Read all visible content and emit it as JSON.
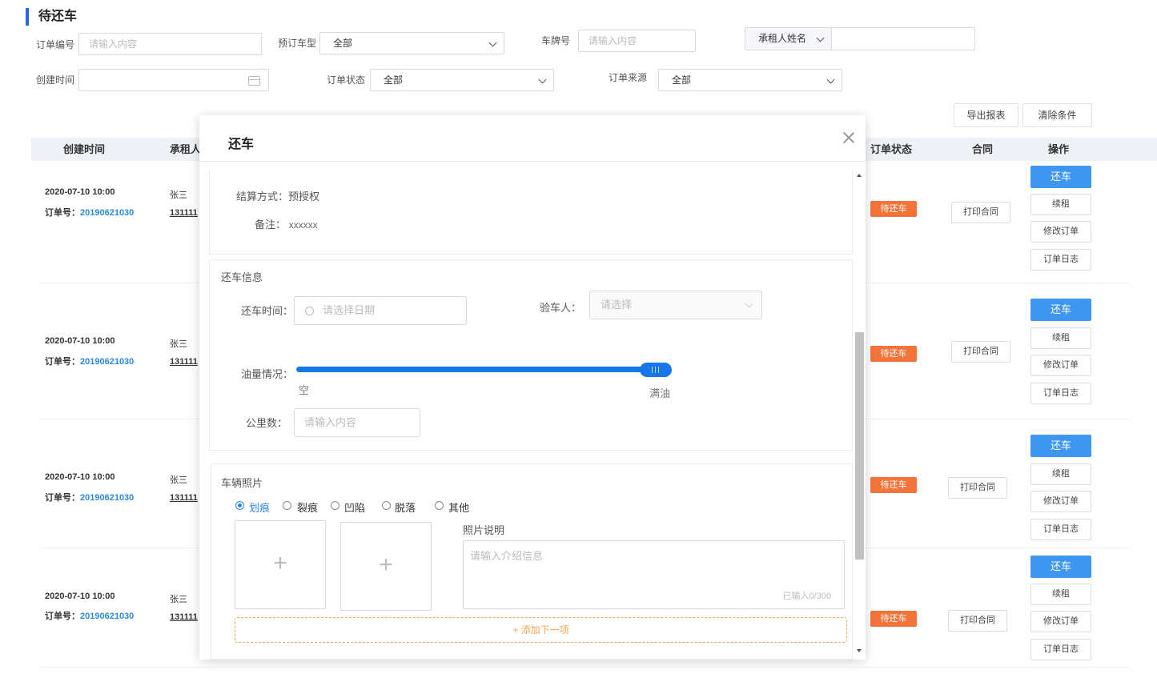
{
  "page": {
    "title": "待还车"
  },
  "filters": {
    "order_no": {
      "label": "订单编号",
      "placeholder": "请输入内容"
    },
    "car_type": {
      "label": "预订车型",
      "value": "全部"
    },
    "plate": {
      "label": "车牌号",
      "placeholder": "请输入内容"
    },
    "renter": {
      "label": "承租人姓名",
      "value": ""
    },
    "created": {
      "label": "创建时间",
      "value": ""
    },
    "status": {
      "label": "订单状态",
      "value": "全部"
    },
    "source": {
      "label": "订单来源",
      "value": "全部"
    }
  },
  "toolbar": {
    "export_label": "导出报表",
    "clear_label": "清除条件"
  },
  "table": {
    "headers": {
      "created": "创建时间",
      "renter": "承租人",
      "status": "订单状态",
      "contract": "合同",
      "action": "操作"
    },
    "order_prefix": "订单号：",
    "rows": [
      {
        "time": "2020-07-10 10:00",
        "order_no": "20190621030",
        "name": "张三",
        "phone": "131111",
        "status": "待还车",
        "contract": "打印合同",
        "actions": [
          "还车",
          "续租",
          "修改订单",
          "订单日志"
        ]
      },
      {
        "time": "2020-07-10 10:00",
        "order_no": "20190621030",
        "name": "张三",
        "phone": "131111",
        "status": "待还车",
        "contract": "打印合同",
        "actions": [
          "还车",
          "续租",
          "修改订单",
          "订单日志"
        ]
      },
      {
        "time": "2020-07-10 10:00",
        "order_no": "20190621030",
        "name": "张三",
        "phone": "131111",
        "status": "待还车",
        "contract": "打印合同",
        "actions": [
          "还车",
          "续租",
          "修改订单",
          "订单日志"
        ]
      },
      {
        "time": "2020-07-10 10:00",
        "order_no": "20190621030",
        "name": "张三",
        "phone": "131111",
        "status": "待还车",
        "contract": "打印合同",
        "actions": [
          "还车",
          "续租",
          "修改订单",
          "订单日志"
        ]
      }
    ]
  },
  "modal": {
    "title": "还车",
    "settlement": {
      "label": "结算方式：",
      "value": "预授权"
    },
    "remark": {
      "label": "备注：",
      "value": "xxxxxx"
    },
    "return_info": {
      "title": "还车信息",
      "time_label": "还车时间：",
      "time_placeholder": "请选择日期",
      "inspector_label": "验车人：",
      "inspector_placeholder": "请选择",
      "fuel_label": "油量情况：",
      "fuel_min": "空",
      "fuel_max": "满油",
      "fuel_level": 1.0,
      "mileage_label": "公里数：",
      "mileage_placeholder": "请输入内容"
    },
    "photos": {
      "title": "车辆照片",
      "options": [
        "划痕",
        "裂痕",
        "凹陷",
        "脱落",
        "其他"
      ],
      "selected": "划痕",
      "desc_label": "照片说明",
      "desc_placeholder": "请输入介绍信息",
      "counter": "已输入0/300",
      "add_next": "+ 添加下一项"
    }
  },
  "colors": {
    "accent": "#3d97f0",
    "status_badge": "#f3743a",
    "link": "#2c8ad8",
    "dashed": "#f3a552"
  }
}
